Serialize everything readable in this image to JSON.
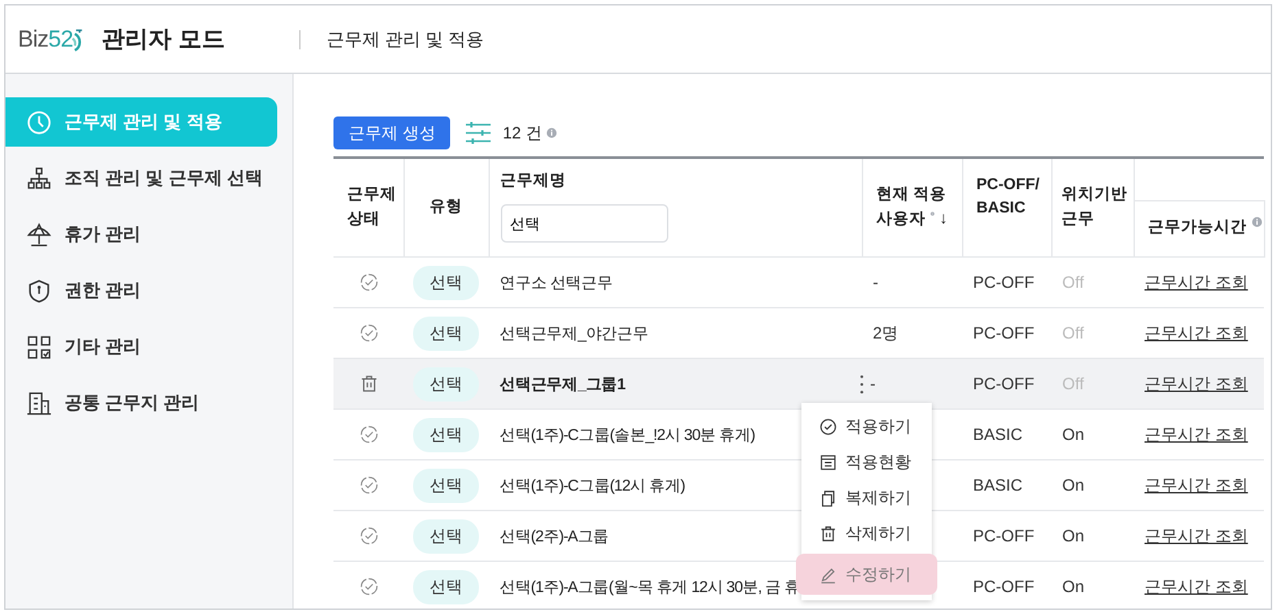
{
  "header": {
    "logo_prefix": "Biz",
    "logo_accent": "52",
    "mode_title": "관리자 모드",
    "breadcrumb": "근무제 관리 및 적용"
  },
  "sidebar": {
    "items": [
      {
        "label": "근무제 관리 및 적용",
        "selected": true
      },
      {
        "label": "조직 관리 및 근무제 선택",
        "selected": false
      },
      {
        "label": "휴가 관리",
        "selected": false
      },
      {
        "label": "권한 관리",
        "selected": false
      },
      {
        "label": "기타 관리",
        "selected": false
      },
      {
        "label": "공통 근무지 관리",
        "selected": false
      }
    ]
  },
  "toolbar": {
    "create_button": "근무제 생성",
    "count": "12 건"
  },
  "table": {
    "columns": {
      "status": "근무제 상태",
      "type": "유형",
      "name": "근무제명",
      "users_line1": "현재 적용",
      "users_line2": "사용자",
      "users_sort": "↓",
      "pc_mode": "PC-OFF/ BASIC",
      "location": "위치기반 근무",
      "hours": "근무가능시간"
    },
    "name_filter": {
      "value": "선택"
    },
    "rows": [
      {
        "hovered": false,
        "type": "선택",
        "name": "연구소 선택근무",
        "users": "-",
        "pc_mode": "PC-OFF",
        "location": "Off",
        "location_on": false,
        "hours_link": "근무시간 조회"
      },
      {
        "hovered": false,
        "type": "선택",
        "name": "선택근무제_야간근무",
        "users": "2명",
        "pc_mode": "PC-OFF",
        "location": "Off",
        "location_on": false,
        "hours_link": "근무시간 조회"
      },
      {
        "hovered": true,
        "type": "선택",
        "name": "선택근무제_그룹1",
        "users": "-",
        "pc_mode": "PC-OFF",
        "location": "Off",
        "location_on": false,
        "hours_link": "근무시간 조회"
      },
      {
        "hovered": false,
        "type": "선택",
        "name": "선택(1주)-C그룹(솔본_!2시 30분 휴게)",
        "users": "",
        "pc_mode": "BASIC",
        "location": "On",
        "location_on": true,
        "hours_link": "근무시간 조회"
      },
      {
        "hovered": false,
        "type": "선택",
        "name": "선택(1주)-C그룹(12시 휴게)",
        "users": "",
        "pc_mode": "BASIC",
        "location": "On",
        "location_on": true,
        "hours_link": "근무시간 조회"
      },
      {
        "hovered": false,
        "type": "선택",
        "name": "선택(2주)-A그룹",
        "users": "",
        "pc_mode": "PC-OFF",
        "location": "On",
        "location_on": true,
        "hours_link": "근무시간 조회"
      },
      {
        "hovered": false,
        "type": "선택",
        "name": "선택(1주)-A그룹(월~목 휴게 12시 30분, 금 휴",
        "users": "",
        "pc_mode": "PC-OFF",
        "location": "On",
        "location_on": true,
        "hours_link": "근무시간 조회"
      }
    ]
  },
  "context_menu": {
    "items": [
      {
        "label": "적용하기",
        "selected": false
      },
      {
        "label": "적용현황",
        "selected": false
      },
      {
        "label": "복제하기",
        "selected": false
      },
      {
        "label": "삭제하기",
        "selected": false
      },
      {
        "label": "수정하기",
        "selected": true
      }
    ]
  }
}
